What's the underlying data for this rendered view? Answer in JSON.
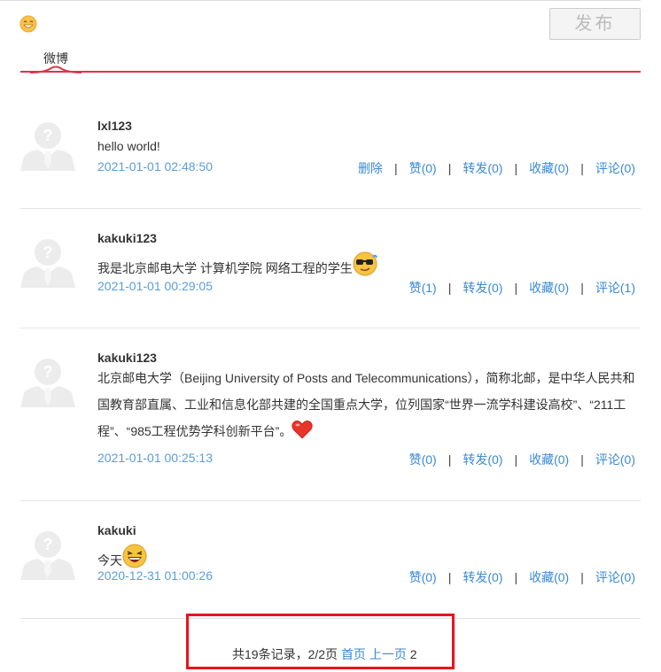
{
  "composer": {
    "publish_label": "发布",
    "emoji_icon": "smiley-face-icon"
  },
  "tabs": {
    "weibo": "微博"
  },
  "colors": {
    "accent": "#e0324a",
    "link": "#3a8ad4",
    "time": "#5a9ed8",
    "highlight_box": "#e8141c"
  },
  "posts": [
    {
      "user": "lxl123",
      "content": "hello world!",
      "time": "2021-01-01 02:48:50",
      "actions": {
        "delete": "删除",
        "like": "赞(0)",
        "repost": "转发(0)",
        "favorite": "收藏(0)",
        "comment": "评论(0)"
      }
    },
    {
      "user": "kakuki123",
      "content": "我是北京邮电大学 计算机学院 网络工程的学生",
      "emoji": "sunglasses-emoji",
      "time": "2021-01-01 00:29:05",
      "actions": {
        "like": "赞(1)",
        "repost": "转发(0)",
        "favorite": "收藏(0)",
        "comment": "评论(1)"
      }
    },
    {
      "user": "kakuki123",
      "content": "北京邮电大学（Beijing University of Posts and Telecommunications），简称北邮，是中华人民共和国教育部直属、工业和信息化部共建的全国重点大学，位列国家“世界一流学科建设高校”、“211工程”、“985工程优势学科创新平台”。",
      "emoji": "heart-emoji",
      "time": "2021-01-01 00:25:13",
      "actions": {
        "like": "赞(0)",
        "repost": "转发(0)",
        "favorite": "收藏(0)",
        "comment": "评论(0)"
      }
    },
    {
      "user": "kakuki",
      "content": "今天",
      "emoji": "laughing-emoji",
      "time": "2020-12-31 01:00:26",
      "actions": {
        "like": "赞(0)",
        "repost": "转发(0)",
        "favorite": "收藏(0)",
        "comment": "评论(0)"
      }
    }
  ],
  "pagination": {
    "summary": "共19条记录，2/2页",
    "first": "首页",
    "prev": "上一页",
    "current": "2"
  }
}
